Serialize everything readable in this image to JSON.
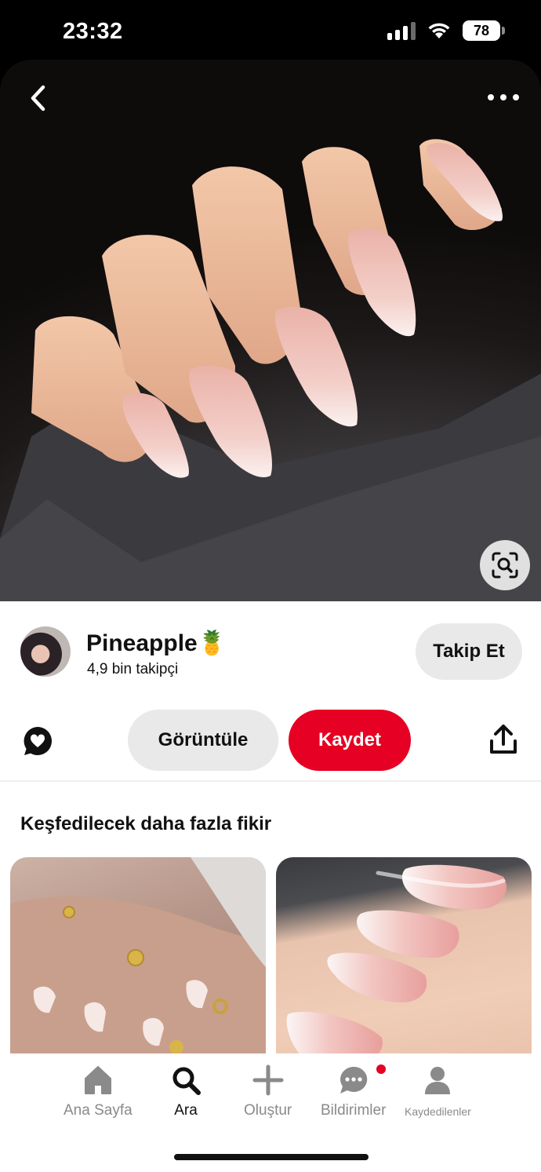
{
  "status_bar": {
    "time": "23:32",
    "battery": "78"
  },
  "pin": {
    "creator_name": "Pineapple🍍",
    "creator_followers": "4,9 bin takipçi",
    "follow_label": "Takip Et",
    "view_label": "Görüntüle",
    "save_label": "Kaydet"
  },
  "more_ideas": {
    "title": "Keşfedilecek daha fazla fikir"
  },
  "bottom_nav": {
    "items": [
      {
        "label": "Ana Sayfa",
        "icon": "home-icon"
      },
      {
        "label": "Ara",
        "icon": "search-icon"
      },
      {
        "label": "Oluştur",
        "icon": "plus-icon"
      },
      {
        "label": "Bildirimler",
        "icon": "chat-bubble-icon"
      },
      {
        "label": "Kaydedilenler",
        "icon": "profile-icon"
      }
    ]
  },
  "colors": {
    "brand_red": "#e60023",
    "pill_gray": "#e9e9e9"
  }
}
